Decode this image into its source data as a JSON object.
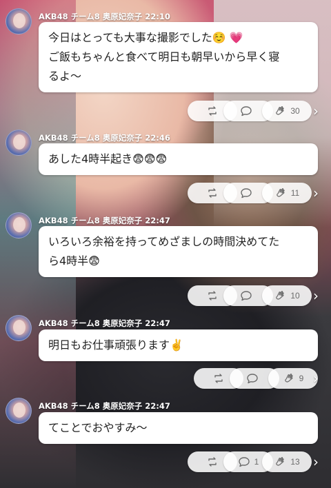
{
  "posts": [
    {
      "author": "AKB48 チーム8 奥原妃奈子",
      "time": "22:10",
      "text": "今日はとっても大事な撮影でした☺️ 💗\nご飯もちゃんと食べて明日も朝早いから早く寝るよ〜",
      "text_lines": [
        "今日はとっても大事な撮影でした☺️ 💗",
        "ご飯もちゃんと食べて明日も朝早いから早く寝",
        "るよ〜"
      ],
      "reply_count": "",
      "clap_count": "30"
    },
    {
      "author": "AKB48 チーム8 奥原妃奈子",
      "time": "22:46",
      "text_lines": [
        "あした4時半起き😨😨😨"
      ],
      "reply_count": "",
      "clap_count": "11"
    },
    {
      "author": "AKB48 チーム8 奥原妃奈子",
      "time": "22:47",
      "text_lines": [
        "いろいろ余裕を持ってめざましの時間決めてた",
        "ら4時半😨"
      ],
      "reply_count": "",
      "clap_count": "10"
    },
    {
      "author": "AKB48 チーム8 奥原妃奈子",
      "time": "22:47",
      "text_lines": [
        "明日もお仕事頑張ります✌️"
      ],
      "reply_count": "",
      "clap_count": "9"
    },
    {
      "author": "AKB48 チーム8 奥原妃奈子",
      "time": "22:47",
      "text_lines": [
        "てことでおやすみ〜"
      ],
      "reply_count": "1",
      "clap_count": "13"
    }
  ],
  "icons": {
    "retweet": "repost-icon",
    "reply": "reply-bubble-icon",
    "clap": "clap-icon",
    "more": "chevron-right-icon"
  },
  "colors": {
    "bubble": "#ffffff",
    "pill": "#ffffff",
    "icon": "#6b6b6b"
  }
}
